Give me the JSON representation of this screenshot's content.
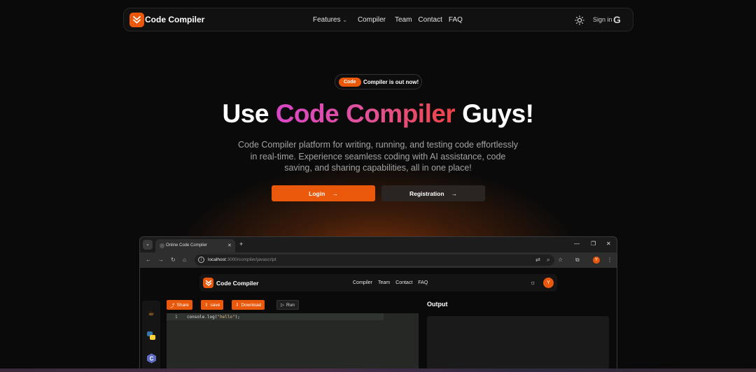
{
  "nav": {
    "brand": "Code Compiler",
    "links": [
      "Features",
      "Compiler",
      "Team",
      "Contact",
      "FAQ"
    ],
    "features_chevron": "⌄",
    "theme_icon": "sun-icon",
    "signin_label": "Sign in",
    "google_icon": "G"
  },
  "hero": {
    "pill_tag": "Code",
    "pill_text": "Compiler is out now!",
    "headline_pre": "Use",
    "headline_highlight": "Code Compiler",
    "headline_post": "Guys!",
    "subtitle": "Code Compiler platform for writing, running, and testing code effortlessly in real-time. Experience seamless coding with AI assistance, code saving, and sharing capabilities, all in one place!",
    "login_label": "Login",
    "register_label": "Registration"
  },
  "browser": {
    "tab_title": "Online Code Compiler",
    "url_host": "localhost",
    "url_path": ":3000/compiler/javascript",
    "profile_initial": "Y",
    "inner": {
      "brand": "Code Compiler",
      "links": [
        "Compiler",
        "Team",
        "Contact",
        "FAQ"
      ],
      "avatar_initial": "Y",
      "toolbar": {
        "share": "Share",
        "save": "save",
        "download": "Download",
        "run": "Run"
      },
      "editor": {
        "line_number": "1",
        "code_prefix": "console.log(",
        "code_string": "\"hello\"",
        "code_suffix": ");"
      },
      "output_label": "Output",
      "languages": [
        "java-icon",
        "python-icon",
        "c-icon"
      ]
    }
  },
  "colors": {
    "accent": "#ea580c",
    "background": "#0a0a0a",
    "gradient_start": "#d946c8",
    "gradient_end": "#ef4444"
  }
}
